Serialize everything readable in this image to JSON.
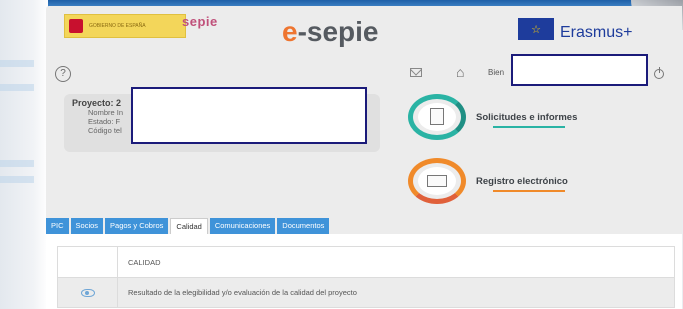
{
  "header": {
    "gov_logo_text": "GOBIERNO DE ESPAÑA",
    "sepie_logo": "sepie",
    "app_title_e": "e",
    "app_title_rest": "-sepie",
    "eu_flag_stars": "☆",
    "erasmus": "Erasmus+"
  },
  "toolbar": {
    "help": "?",
    "home": "⌂",
    "welcome": "Bien"
  },
  "project": {
    "title": "Proyecto: 2",
    "line1": "Nombre In",
    "line2": "Estado:  F",
    "line3": "Código tel"
  },
  "links": {
    "solicitudes": "Solicitudes e informes",
    "registro": "Registro electrónico"
  },
  "tabs": [
    {
      "label": "PIC"
    },
    {
      "label": "Socios"
    },
    {
      "label": "Pagos y Cobros"
    },
    {
      "label": "Calidad"
    },
    {
      "label": "Comunicaciones"
    },
    {
      "label": "Documentos"
    }
  ],
  "table": {
    "header": "CALIDAD",
    "row1": "Resultado de la elegibilidad y/o evaluación de la calidad del proyecto"
  },
  "colors": {
    "tab_blue": "#3f93d9",
    "teal": "#2ab3a4",
    "orange": "#f08a2a",
    "redaction_border": "#1b1b7a"
  },
  "icons": [
    "help-icon",
    "mail-icon",
    "home-icon",
    "power-icon",
    "document-icon",
    "envelope-icon",
    "eye-icon"
  ]
}
